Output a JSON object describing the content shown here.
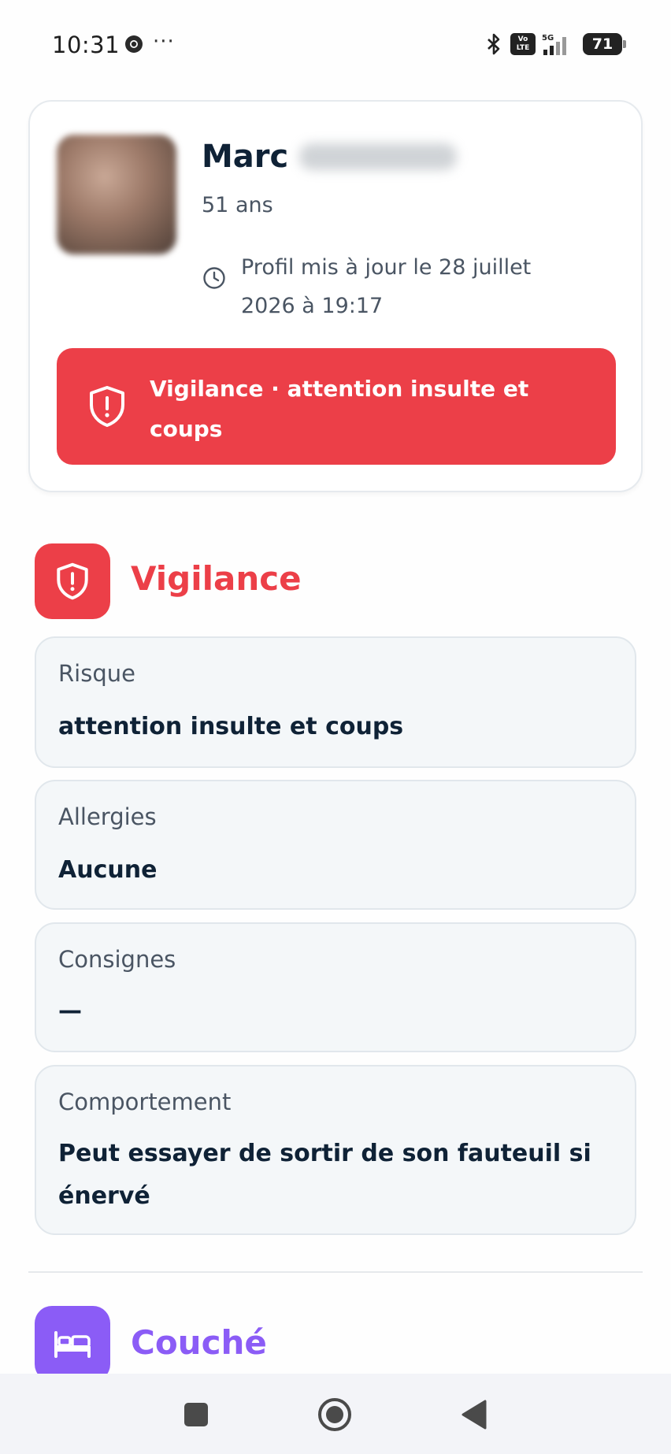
{
  "status_bar": {
    "time": "10:31",
    "dots": "···",
    "volte_top": "Vo",
    "volte_bottom": "LTE",
    "battery": "71"
  },
  "profile": {
    "first_name": "Marc",
    "age": "51 ans",
    "updated": "Profil mis à jour le 28 juillet 2026 à 19:17",
    "alert": "Vigilance · attention insulte et coups"
  },
  "vigilance": {
    "title": "Vigilance",
    "color": "#ec3f48",
    "items": [
      {
        "label": "Risque",
        "value": "attention insulte et coups"
      },
      {
        "label": "Allergies",
        "value": "Aucune"
      },
      {
        "label": "Consignes",
        "value": "—"
      },
      {
        "label": "Comportement",
        "value": "Peut essayer de sortir de son fauteuil si énervé"
      }
    ]
  },
  "couche": {
    "title": "Couché",
    "color": "#8b5cf6"
  },
  "icons": {
    "clock": "clock-icon",
    "shield": "shield-alert-icon",
    "bed": "bed-icon"
  }
}
